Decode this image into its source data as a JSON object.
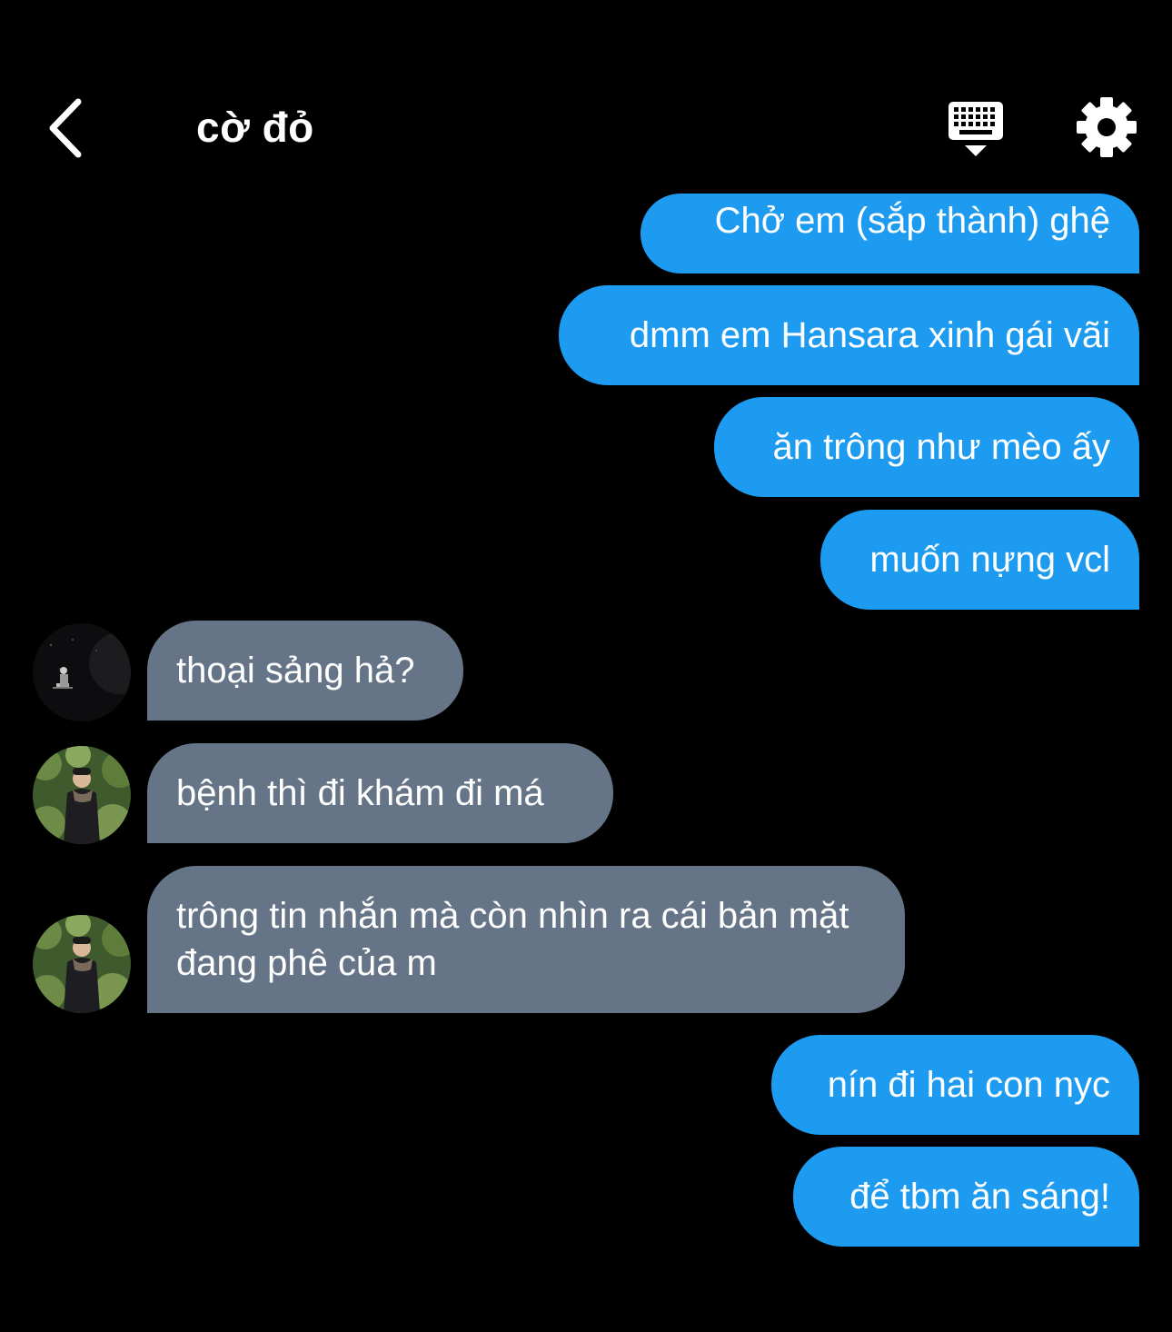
{
  "header": {
    "title": "cờ đỏ",
    "back_icon": "chevron-left-icon",
    "keyboard_icon": "keyboard-icon",
    "settings_icon": "gear-icon"
  },
  "messages": [
    {
      "side": "out",
      "text": "Chở em (sắp thành) ghệ"
    },
    {
      "side": "out",
      "text": "dmm em Hansara xinh gái vãi"
    },
    {
      "side": "out",
      "text": "ăn trông như mèo ấy"
    },
    {
      "side": "out",
      "text": "muốn nựng vcl"
    },
    {
      "side": "in",
      "text": "thoại sảng hả?",
      "avatar": "avatar-dark-stage"
    },
    {
      "side": "in",
      "text": "bệnh thì đi khám đi má",
      "avatar": "avatar-garden"
    },
    {
      "side": "in",
      "text": "trông tin nhắn mà còn nhìn ra cái bản mặt đang phê của m",
      "avatar": "avatar-garden"
    },
    {
      "side": "out",
      "text": "nín đi hai con nyc"
    },
    {
      "side": "out",
      "text": "để tbm ăn sáng!"
    }
  ],
  "colors": {
    "background": "#000000",
    "outgoing_bubble": "#1d9bf0",
    "incoming_bubble": "#657587",
    "text": "#ffffff"
  }
}
